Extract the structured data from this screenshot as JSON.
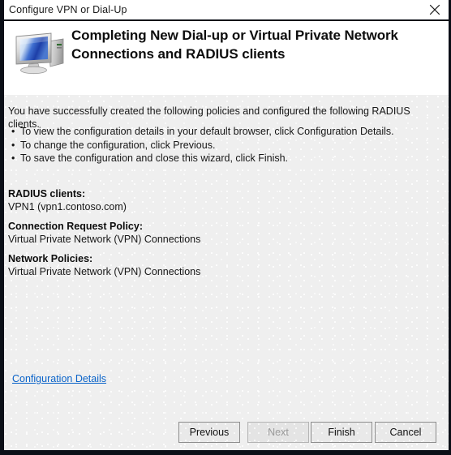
{
  "window": {
    "titlebar_title": "Configure VPN or Dial-Up",
    "close_icon": "close-icon"
  },
  "header": {
    "icon": "computer-monitor-icon",
    "title": "Completing New Dial-up or Virtual Private Network Connections and RADIUS clients"
  },
  "body": {
    "intro": "You have successfully created the following policies and configured the following RADIUS clients.",
    "bullets": [
      {
        "marker": "•",
        "text": "To view the configuration details in your default browser, click Configuration Details."
      },
      {
        "marker": "•",
        "text": "To change the configuration, click Previous."
      },
      {
        "marker": "•",
        "text": "To save the configuration and close this wizard, click Finish."
      }
    ],
    "summary": [
      {
        "heading": "RADIUS clients:",
        "value": "VPN1 (vpn1.contoso.com)"
      },
      {
        "heading": "Connection Request Policy:",
        "value": "Virtual Private Network (VPN) Connections"
      },
      {
        "heading": "Network Policies:",
        "value": "Virtual Private Network (VPN) Connections"
      }
    ],
    "config_details_link": "Configuration Details"
  },
  "buttons": {
    "previous": "Previous",
    "next": "Next",
    "finish": "Finish",
    "cancel": "Cancel"
  },
  "colors": {
    "link": "#0a63c9",
    "panel_bg": "#efefef",
    "border": "#0b0f17",
    "disabled_text": "#9a9a9a"
  }
}
